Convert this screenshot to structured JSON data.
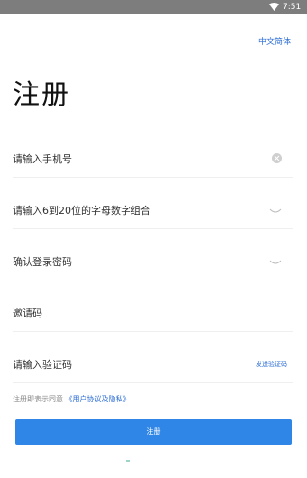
{
  "status_bar": {
    "time": "7:51"
  },
  "header": {
    "language_link": "中文简体"
  },
  "page": {
    "title": "注册"
  },
  "form": {
    "phone_placeholder": "请输入手机号",
    "password_placeholder": "请输入6到20位的字母数字组合",
    "confirm_password_placeholder": "确认登录密码",
    "invite_code_placeholder": "邀请码",
    "verification_placeholder": "请输入验证码",
    "send_code_label": "发送验证码"
  },
  "agreement": {
    "prefix": "注册即表示同意",
    "link": "《用户协议及隐私》"
  },
  "submit": {
    "label": "注册"
  },
  "colors": {
    "accent": "#2f86e6",
    "link": "#2f6fd6",
    "status_bar": "#7d7d7d"
  }
}
